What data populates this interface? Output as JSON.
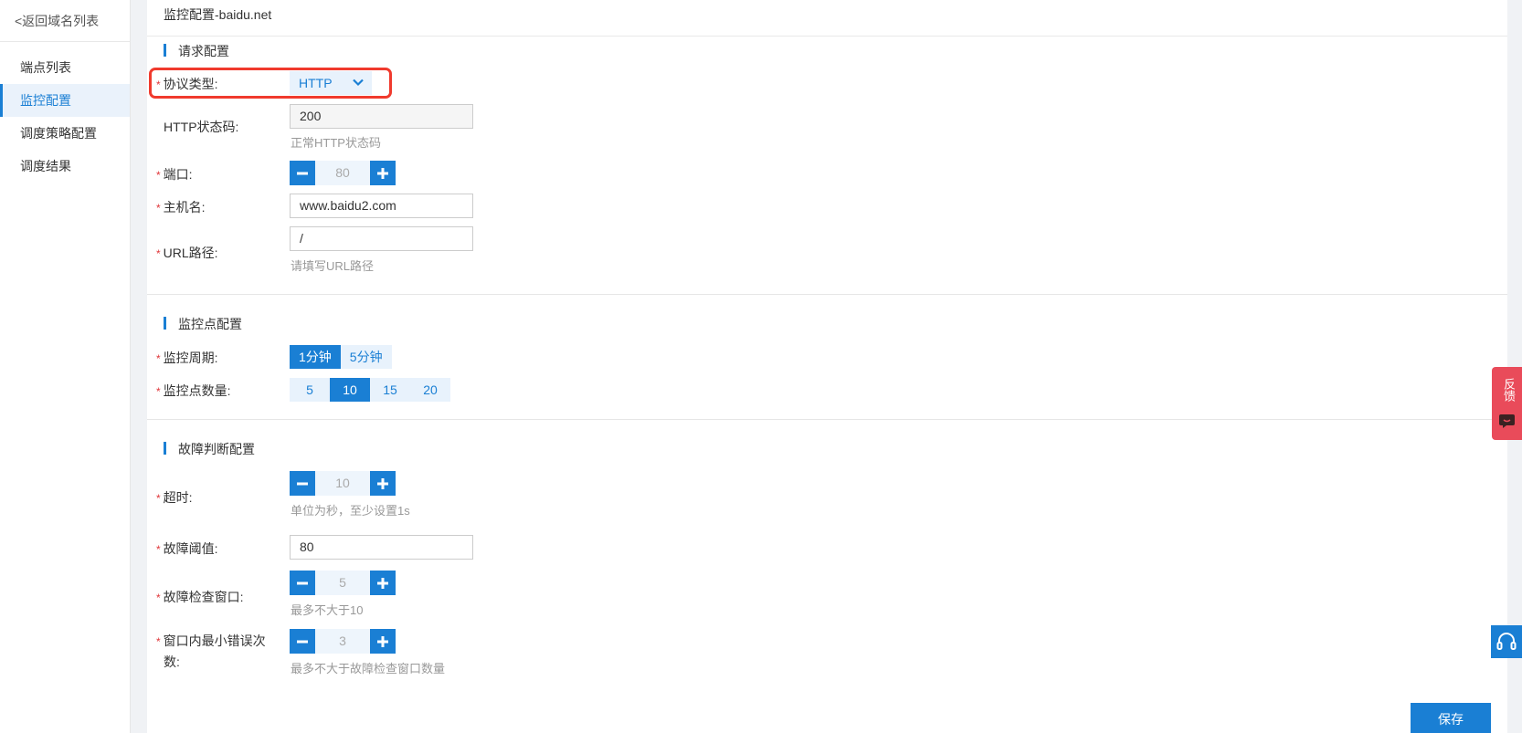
{
  "sidebar": {
    "back_label": "<返回域名列表",
    "items": [
      {
        "label": "端点列表"
      },
      {
        "label": "监控配置"
      },
      {
        "label": "调度策略配置"
      },
      {
        "label": "调度结果"
      }
    ],
    "active_index": 1
  },
  "page_title": "监控配置-baidu.net",
  "request_section": {
    "title": "请求配置",
    "protocol": {
      "label": "协议类型:",
      "value": "HTTP"
    },
    "status_code": {
      "label": "HTTP状态码:",
      "value": "200",
      "hint": "正常HTTP状态码"
    },
    "port": {
      "label": "端口:",
      "value": "80"
    },
    "hostname": {
      "label": "主机名:",
      "value": "www.baidu2.com"
    },
    "url_path": {
      "label": "URL路径:",
      "value": "/",
      "hint": "请填写URL路径"
    }
  },
  "monitor_section": {
    "title": "监控点配置",
    "period": {
      "label": "监控周期:",
      "options": [
        "1分钟",
        "5分钟"
      ],
      "selected": "1分钟"
    },
    "count": {
      "label": "监控点数量:",
      "options": [
        "5",
        "10",
        "15",
        "20"
      ],
      "selected": "10"
    }
  },
  "fault_section": {
    "title": "故障判断配置",
    "timeout": {
      "label": "超时:",
      "value": "10",
      "hint": "单位为秒，至少设置1s"
    },
    "threshold": {
      "label": "故障阈值:",
      "value": "80"
    },
    "window": {
      "label": "故障检查窗口:",
      "value": "5",
      "hint": "最多不大于10"
    },
    "min_errors": {
      "label_line1": "窗口内最小错误次",
      "label_line2": "数:",
      "value": "3",
      "hint": "最多不大于故障检查窗口数量"
    }
  },
  "required_mark": "*",
  "save_label": "保存",
  "feedback_label": "反馈",
  "colors": {
    "accent": "#1a7fd4",
    "required": "#e0363a",
    "highlight": "#f03a2d",
    "feedback": "#e94b5a"
  }
}
